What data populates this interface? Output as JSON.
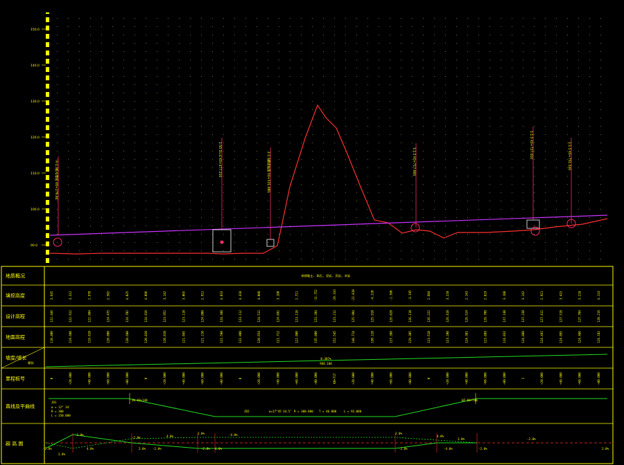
{
  "colors": {
    "background": "#000000",
    "grid_dot": "#5a7a2a",
    "frame": "#ffff00",
    "ground_line": "#ff3030",
    "design_line": "#cc33ff",
    "station_marker": "#ff2a6a",
    "slope_line": "#22dd22",
    "curve_line": "#22dd22"
  },
  "y_axis": {
    "ticks": [
      "150.0",
      "140.0",
      "130.0",
      "120.0",
      "110.0",
      "100.0",
      "90.0"
    ]
  },
  "station_annotations": [
    "R-1:3桩号等桩 K0+279.84",
    "1:50 D=4 K0+477.210",
    "1:1.5路堤拓宽 K0+531.080",
    "1:1.5 K0+717.660",
    "1:1.5 K0+727.010",
    "1:1.5 K0+751.540"
  ],
  "table": {
    "rows": [
      {
        "label": "地质概况",
        "summary": "粉质黏土, 砾石, 泥岩, 页岩, 灰岩"
      },
      {
        "label": "填挖高度"
      },
      {
        "label": "设计高程"
      },
      {
        "label": "地面高程"
      },
      {
        "label": "坡度/坡长",
        "left_top": "坡度",
        "left_bottom": "坡长"
      },
      {
        "label": "里程桩号"
      },
      {
        "label": "直线及平曲线"
      },
      {
        "label": "超 高 图"
      }
    ],
    "cut_fill": [
      "3.645",
      "3.312",
      "2.978",
      "2.502",
      "4.025",
      "4.096",
      "3.142",
      "3.065",
      "2.912",
      "4.033",
      "4.418",
      "4.088",
      "3.180",
      "2.711",
      "-11.752",
      "-29.333",
      "-22.810",
      "-4.210",
      "-1.360",
      "-3.195",
      "2.604",
      "3.210",
      "2.143",
      "2.819",
      "3.108",
      "3.142",
      "2.921",
      "3.415",
      "3.218",
      "4.114"
    ],
    "design_elev": [
      "122.446",
      "122.912",
      "122.804",
      "124.475",
      "124.702",
      "124.916",
      "123.952",
      "123.110",
      "124.008",
      "124.388",
      "123.112",
      "124.512",
      "124.892",
      "123.118",
      "123.204",
      "123.212",
      "125.904",
      "125.918",
      "126.020",
      "126.110",
      "126.222",
      "126.418",
      "126.524",
      "126.708",
      "127.140",
      "127.230",
      "127.412",
      "127.510",
      "127.704",
      "128.216"
    ],
    "ground_elev": [
      "118.800",
      "119.600",
      "119.810",
      "120.000",
      "120.680",
      "120.820",
      "120.810",
      "121.045",
      "121.210",
      "121.500",
      "122.000",
      "120.654",
      "121.712",
      "122.000",
      "135.000",
      "152.545",
      "148.714",
      "130.128",
      "127.380",
      "129.305",
      "123.618",
      "123.208",
      "124.381",
      "123.889",
      "124.032",
      "124.088",
      "124.491",
      "124.095",
      "124.486",
      "124.102"
    ],
    "grade": {
      "value": "0.387%",
      "length": "968.100"
    },
    "stations": [
      "0",
      "+20.000",
      "+40.000",
      "+60.000",
      "+80.000",
      "0",
      "+20.000",
      "+40.000",
      "+60.000",
      "+80.000",
      "0",
      "+20.000",
      "+40.000",
      "+60.000",
      "+80.000",
      "K0+717",
      "+20.000",
      "+40.000",
      "+60.000",
      "+80.000",
      "0",
      "+20.000",
      "+40.000",
      "+60.000",
      "+80.000",
      "1",
      "+20.000",
      "+40.000",
      "+60.000",
      "+80.000"
    ],
    "curve": {
      "start_label": "JD1",
      "params": [
        "α = 12° 34′",
        "R = 300",
        "L = 150.000"
      ],
      "mid_text": [
        "JD2",
        "α=17°45′34.5″",
        "R = 300.000",
        "T = 46.800",
        "L = 93.000"
      ],
      "tag_left": "ZH K0+148",
      "tag_right": "HZ K0+740"
    },
    "superelevation": {
      "labels": [
        "-2.0%",
        "2.0%",
        "-2.0%",
        "4.0%",
        "-2.0%",
        "2.0%",
        "-2.0%",
        "4.0%",
        "2.0%",
        "-2.0%",
        "4.0%",
        "-4.0%",
        "2.0%",
        "-2.0%",
        "4.0%",
        "-4.0%",
        "2.0%",
        "-2.0%",
        "2.0%",
        "-2.0%"
      ]
    }
  }
}
